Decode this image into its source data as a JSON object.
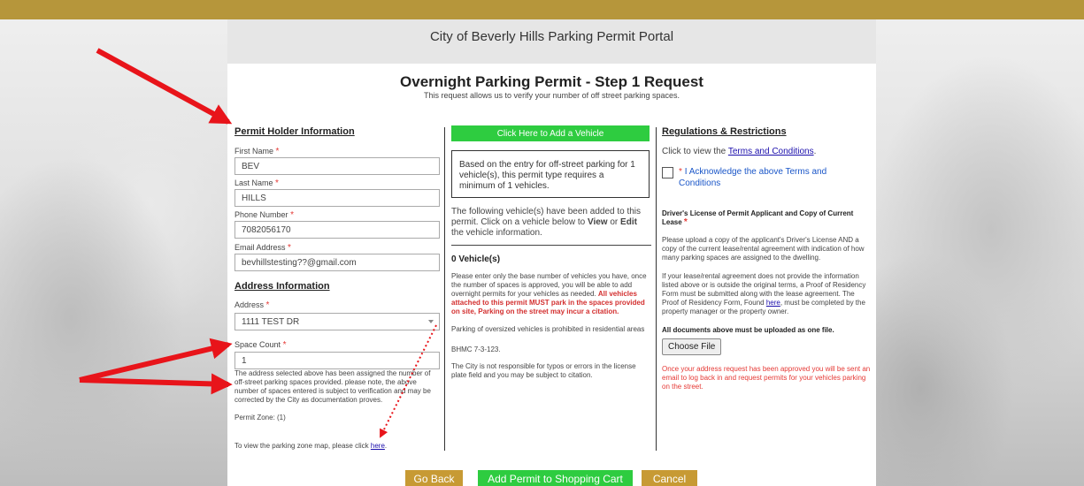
{
  "portal_title": "City of Beverly Hills Parking Permit Portal",
  "page": {
    "title": "Overnight Parking Permit - Step 1 Request",
    "subtitle": "This request allows us to verify your number of off street parking spaces."
  },
  "permit_holder": {
    "heading": "Permit Holder Information",
    "first_name_label": "First Name",
    "first_name_value": "BEV",
    "last_name_label": "Last Name",
    "last_name_value": "HILLS",
    "phone_label": "Phone Number",
    "phone_value": "7082056170",
    "email_label": "Email Address",
    "email_value": "bevhillstesting??@gmail.com",
    "required_mark": "*"
  },
  "address_info": {
    "heading": "Address Information",
    "address_label": "Address",
    "address_value": "1111 TEST DR",
    "space_count_label": "Space Count",
    "space_count_value": "1",
    "note": "The address selected above has been assigned the number of off-street parking spaces provided. please note, the above number of spaces entered is subject to verification and may be corrected by the City as documentation proves.",
    "permit_zone": "Permit Zone: (1)",
    "zone_map_text": "To view the parking zone map, please click",
    "zone_map_link": "here",
    "zone_map_period": "."
  },
  "vehicles": {
    "add_button": "Click Here to Add a Vehicle",
    "requirement_box": "Based on the entry for off-street parking for 1 vehicle(s), this permit type requires a minimum of 1 vehicles.",
    "added_text_1": "The following vehicle(s) have been added to this permit. Click on a vehicle below to",
    "view_word": "View",
    "or_word": "or",
    "edit_word": "Edit",
    "added_text_2": "the vehicle information.",
    "count_heading": "0 Vehicle(s)",
    "base_note": "Please enter only the base number of vehicles you have, once the number of spaces is approved, you will be able to add overnight permits for your vehicles as needed.",
    "base_note_red": "All vehicles attached to this permit MUST park in the spaces provided on site, Parking on the street may incur a citation.",
    "oversized": "Parking of oversized vehicles is prohibited in residential areas",
    "bhmc": "BHMC 7-3-123.",
    "responsibility": "The City is not responsible for typos or errors in the license plate field and you may be subject to citation."
  },
  "regulations": {
    "heading": "Regulations & Restrictions",
    "terms_text": "Click to view the",
    "terms_link": "Terms and Conditions",
    "terms_period": ".",
    "acknowledge": "I Acknowledge the above Terms and Conditions",
    "license_heading": "Driver's License of Permit Applicant and Copy of Current Lease",
    "upload_text": "Please upload a copy of the applicant's Driver's License AND a copy of the current lease/rental agreement with indication of how many parking spaces are assigned to the dwelling.",
    "residency_text_1": "If your lease/rental agreement does not provide the information listed above or is outside the original terms, a Proof of Residency Form must be submitted along with the lease agreement. The Proof of Residency Form, Found",
    "residency_link": "here",
    "residency_text_2": ", must be completed by the property manager or the property owner.",
    "all_docs": "All documents above must be uploaded as one file.",
    "choose_file": "Choose File",
    "approval_note": "Once your address request has been approved you will be sent an email to log back in and request permits for your vehicles parking on the street."
  },
  "actions": {
    "go_back": "Go Back",
    "add_to_cart": "Add Permit to Shopping Cart",
    "cancel": "Cancel"
  },
  "colors": {
    "topbar": "#b6963b",
    "green": "#2ecc40",
    "gold_button": "#c79a34",
    "required": "#e53935",
    "annotation_arrow": "#e8141a"
  }
}
